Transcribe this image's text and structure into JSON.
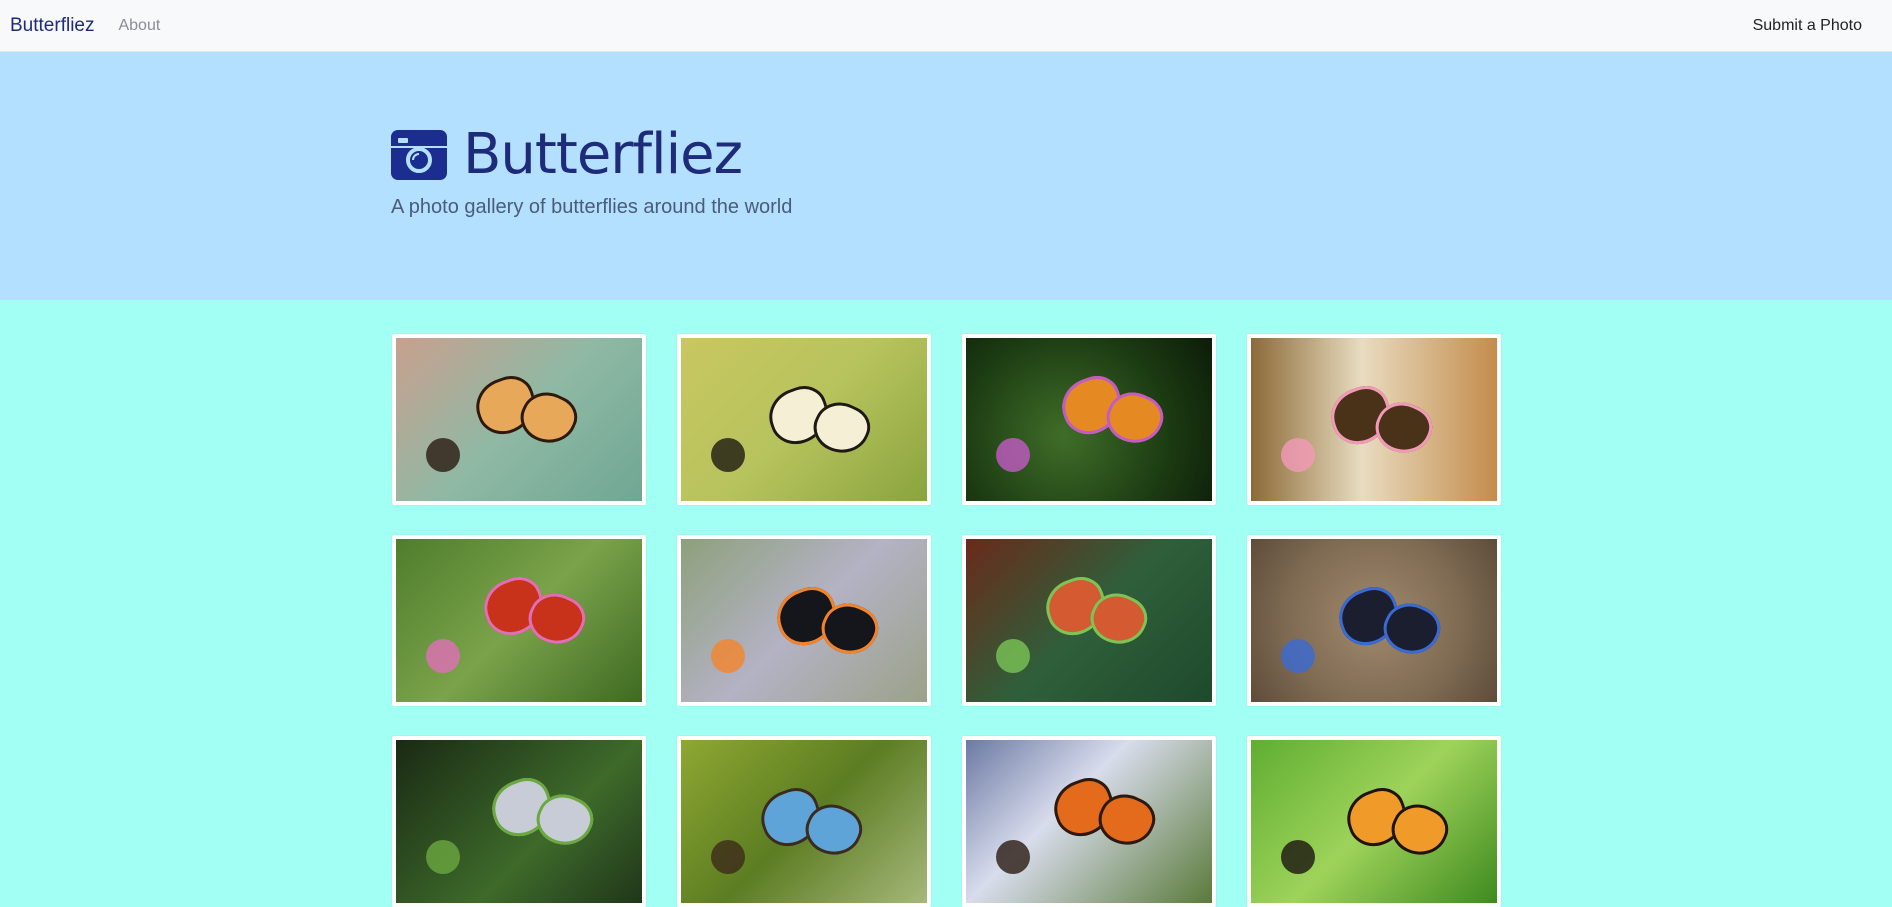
{
  "navbar": {
    "brand": "Butterfliez",
    "about": "About",
    "submit": "Submit a Photo"
  },
  "hero": {
    "title": "Butterfliez",
    "subtitle": "A photo gallery of butterflies around the world",
    "icon": "camera-icon"
  },
  "gallery": {
    "photos": [
      {
        "bg": "linear-gradient(135deg,#c9a08e 0%,#8fb9a4 50%,#6fa794 100%)",
        "wing": "#e8a85a",
        "accent": "#2a1a10"
      },
      {
        "bg": "linear-gradient(135deg,#c9c760 0%,#b7c35d 50%,#8aa43e 100%)",
        "wing": "#f4efd5",
        "accent": "#1e1a12"
      },
      {
        "bg": "radial-gradient(circle at 40% 60%,#3f6e28 0%,#1b3a12 60%,#0c1c08 100%)",
        "wing": "#e58a23",
        "accent": "#c35bc6"
      },
      {
        "bg": "linear-gradient(90deg,#8c6a38 0%,#e8dcc0 45%,#c48c4c 100%)",
        "wing": "#4a3218",
        "accent": "#f29ab8"
      },
      {
        "bg": "linear-gradient(135deg,#4f7d2c 0%,#7aa34a 50%,#3e6a22 100%)",
        "wing": "#c8321a",
        "accent": "#e06fb8"
      },
      {
        "bg": "linear-gradient(135deg,#8da07c 0%,#b4b2c4 50%,#9aa289 100%)",
        "wing": "#15161c",
        "accent": "#f4842a"
      },
      {
        "bg": "linear-gradient(135deg,#6a2a1a 0%,#2f5f3a 50%,#1e4a2c 100%)",
        "wing": "#d45a32",
        "accent": "#7bc456"
      },
      {
        "bg": "radial-gradient(circle,#a08a6e 0%,#7e6a52 60%,#5e4c3a 100%)",
        "wing": "#1a1e2e",
        "accent": "#3a6ad4"
      },
      {
        "bg": "linear-gradient(135deg,#1a2a14 0%,#3d6a2a 60%,#20361a 100%)",
        "wing": "#c7ccd6",
        "accent": "#6aa840"
      },
      {
        "bg": "linear-gradient(135deg,#8fa832 0%,#5c7d22 50%,#a6b87a 100%)",
        "wing": "#5fa4d8",
        "accent": "#3c2a1a"
      },
      {
        "bg": "linear-gradient(135deg,#6c7aa4 0%,#d8dcec 40%,#5a7a3a 100%)",
        "wing": "#e46a1c",
        "accent": "#2a1a12"
      },
      {
        "bg": "linear-gradient(135deg,#5fae32 0%,#9ed35a 50%,#3e8a1f 100%)",
        "wing": "#f09a2a",
        "accent": "#1c1410"
      }
    ]
  }
}
